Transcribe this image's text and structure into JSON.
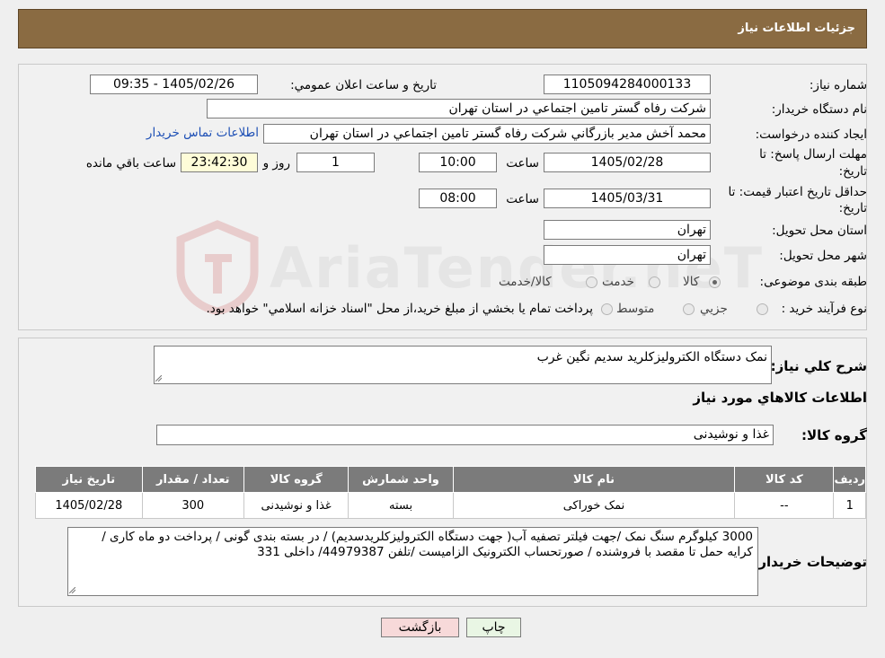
{
  "header": {
    "title": "جزئیات اطلاعات نیاز"
  },
  "need_number": {
    "label": "شماره نیاز:",
    "value": "1105094284000133"
  },
  "announce": {
    "label": "تاریخ و ساعت اعلان عمومي:",
    "value": "1405/02/26 - 09:35"
  },
  "buyer_org": {
    "label": "نام دستگاه خريدار:",
    "value": "شرکت رفاه گستر تامين اجتماعي در استان تهران"
  },
  "requester": {
    "label": "ايجاد کننده درخواست:",
    "value": "محمد آخش مدير بازرگاني شرکت رفاه گستر تامين اجتماعي در استان تهران",
    "contact_link": "اطلاعات تماس خريدار"
  },
  "reply_deadline": {
    "label_line1": "مهلت ارسال پاسخ: تا",
    "label_line2": "تاريخ:",
    "date": "1405/02/28",
    "time_label": "ساعت",
    "time": "10:00",
    "days": "1",
    "days_label": "روز و",
    "remaining": "23:42:30",
    "remaining_label": "ساعت باقي مانده"
  },
  "price_validity": {
    "label_line1": "حداقل تاريخ اعتبار قيمت: تا",
    "label_line2": "تاريخ:",
    "date": "1405/03/31",
    "time_label": "ساعت",
    "time": "08:00"
  },
  "province": {
    "label": "استان محل تحويل:",
    "value": "تهران"
  },
  "city": {
    "label": "شهر محل تحويل:",
    "value": "تهران"
  },
  "category": {
    "label": "طبقه بندی موضوعی:",
    "options": [
      "کالا",
      "خدمت",
      "کالا/خدمت"
    ],
    "selected": "کالا"
  },
  "purchase_type": {
    "label": "نوع فرآيند خريد :",
    "options": [
      "جزيي",
      "متوسط"
    ],
    "note": "پرداخت تمام يا بخشي از مبلغ خريد،از محل \"اسناد خزانه اسلامي\" خواهد بود."
  },
  "description": {
    "label": "شرح کلي نياز:",
    "value": "نمک دستگاه الکترولیزکلرید سدیم نگین غرب"
  },
  "goods_info_title": "اطلاعات کالاهاي مورد نياز",
  "goods_group": {
    "label": "گروه کالا:",
    "value": "غذا و نوشیدنی"
  },
  "table": {
    "headers": [
      "رديف",
      "کد کالا",
      "نام کالا",
      "واحد شمارش",
      "گروه کالا",
      "تعداد / مقدار",
      "تاريخ نياز"
    ],
    "rows": [
      [
        "1",
        "--",
        "نمک خوراکی",
        "بسته",
        "غذا و نوشیدنی",
        "300",
        "1405/02/28"
      ]
    ]
  },
  "buyer_notes": {
    "label": "توضيحات خريدار:",
    "value": "3000 کیلوگرم سنگ نمک /جهت فیلتر تصفیه آب( جهت دستگاه الکترولیزکلریدسدیم) / در بسته بندی گونی / پرداخت دو ماه کاری / کرایه حمل تا مقصد با فروشنده / صورتحساب الکترونیک الزامیست /تلفن 44979387/ داخلی 331"
  },
  "buttons": {
    "print": "چاپ",
    "back": "بازگشت"
  },
  "watermark": "AriaTender.neT",
  "colors": {
    "header_bg": "#8a6b42",
    "table_header_bg": "#7b7b7b",
    "link": "#1d4fb5",
    "remaining_bg": "#fefcd8",
    "back_button_bg": "#f7d9d9"
  }
}
